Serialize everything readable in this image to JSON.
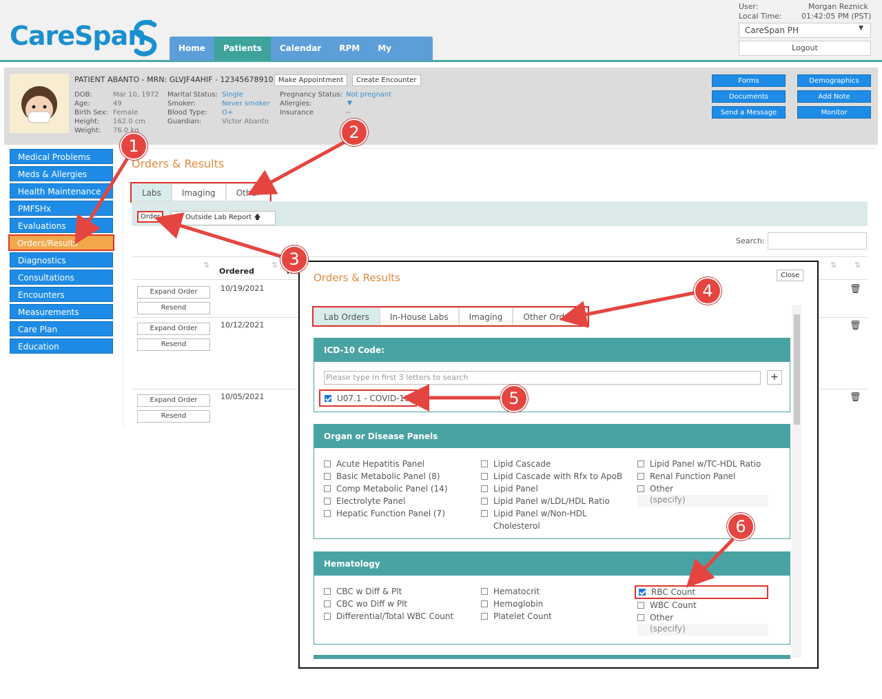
{
  "header": {
    "logo_text": "CareSpan",
    "user_label": "User:",
    "user_value": "Morgan Reznick",
    "time_label": "Local Time:",
    "time_value": "01:42:05 PM (PST)",
    "clinic_select": "CareSpan PH",
    "logout": "Logout"
  },
  "nav": [
    "Home",
    "Patients",
    "Calendar",
    "RPM",
    "My Account ▾"
  ],
  "patient": {
    "title": "PATIENT ABANTO - MRN: GLVJF4AHIF - 12345678910",
    "make_appt": "Make Appointment",
    "create_enc": "Create Encounter",
    "col1": [
      [
        "DOB:",
        "Mar 10, 1972"
      ],
      [
        "Age:",
        "49"
      ],
      [
        "Birth Sex:",
        "Female"
      ],
      [
        "Height:",
        "162.0 cm"
      ],
      [
        "Weight:",
        "76.0 kg"
      ]
    ],
    "col2": [
      [
        "Marital Status:",
        "Single"
      ],
      [
        "Smoker:",
        "Never smoker"
      ],
      [
        "Blood Type:",
        "O+"
      ],
      [
        "Guardian:",
        "Victor Abanto"
      ]
    ],
    "col3": [
      [
        "Pregnancy Status:",
        "Not pregnant"
      ],
      [
        "Allergies:",
        ""
      ],
      [
        "Insurance",
        "--"
      ]
    ],
    "buttons": [
      "Forms",
      "Demographics",
      "Documents",
      "Add Note",
      "Send a Message",
      "Monitor"
    ]
  },
  "sidebar": [
    "Medical Problems",
    "Meds & Allergies",
    "Health Maintenance",
    "PMFSHx",
    "Evaluations",
    "Orders/Results",
    "Diagnostics",
    "Consultations",
    "Encounters",
    "Measurements",
    "Care Plan",
    "Education"
  ],
  "main": {
    "title": "Orders & Results",
    "tabs": [
      "Labs",
      "Imaging",
      "Other"
    ],
    "order_btn": "Order",
    "outside_btn": "Outside Lab Report 🡅",
    "search_label": "Search:",
    "col_ordered": "Ordered",
    "col_na": "Na",
    "rows": [
      {
        "expand": "Expand Order",
        "resend": "Resend",
        "date": "10/19/2021"
      },
      {
        "expand": "Expand Order",
        "resend": "Resend",
        "date": "10/12/2021"
      },
      {
        "expand": "Expand Order",
        "resend": "Resend",
        "date": "10/05/2021"
      }
    ]
  },
  "modal": {
    "title": "Orders & Results",
    "close": "Close",
    "tabs": [
      "Lab Orders",
      "In-House Labs",
      "Imaging",
      "Other Orders"
    ],
    "icd_header": "ICD-10 Code:",
    "icd_placeholder": "Please type in first 3 letters to search",
    "icd_plus": "+",
    "icd_selected": "U07.1 - COVID-19",
    "organ_header": "Organ or Disease Panels",
    "organ_col1": [
      "Acute Hepatitis Panel",
      "Basic Metabolic Panel (8)",
      "Comp Metabolic Panel (14)",
      "Electrolyte Panel",
      "Hepatic Function Panel (7)"
    ],
    "organ_col2": [
      "Lipid Cascade",
      "Lipid Cascade with Rfx to ApoB",
      "Lipid Panel",
      "Lipid Panel w/LDL/HDL Ratio",
      "Lipid Panel w/Non-HDL",
      "Cholesterol"
    ],
    "organ_col3": [
      "Lipid Panel w/TC-HDL Ratio",
      "Renal Function Panel",
      "Other"
    ],
    "specify": "(specify)",
    "hema_header": "Hematology",
    "hema_col1": [
      "CBC w Diff & Plt",
      "CBC wo Diff w Plt",
      "Differential/Total WBC Count"
    ],
    "hema_col2": [
      "Hematocrit",
      "Hemoglobin",
      "Platelet Count"
    ],
    "hema_col3": [
      "RBC Count",
      "WBC Count",
      "Other"
    ]
  },
  "callouts": [
    "1",
    "2",
    "3",
    "4",
    "5",
    "6"
  ]
}
